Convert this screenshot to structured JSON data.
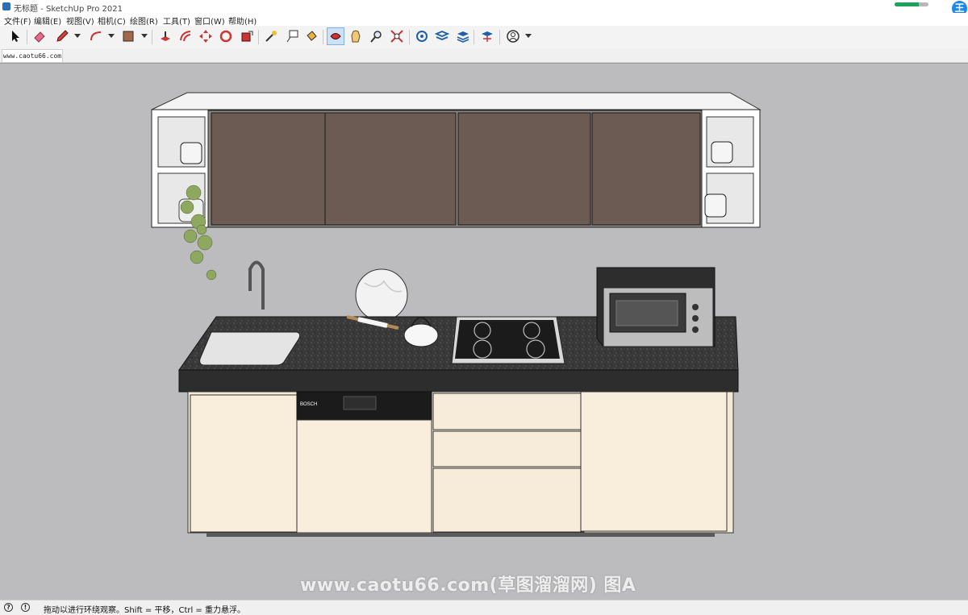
{
  "window": {
    "title": "无标题 - SketchUp Pro 2021",
    "user_initial": "王",
    "progress_fraction": 0.72
  },
  "menu": {
    "items": [
      "文件(F)",
      "编辑(E)",
      "视图(V)",
      "相机(C)",
      "绘图(R)",
      "工具(T)",
      "窗口(W)",
      "帮助(H)"
    ]
  },
  "toolbar": {
    "tools": [
      "select-tool",
      "eraser-tool",
      "pencil-tool",
      "arc-tool",
      "shape-tool",
      "push-pull-tool",
      "offset-tool",
      "move-tool",
      "rotate-tool",
      "scale-tool",
      "tape-measure-tool",
      "text-tool",
      "paint-bucket-tool",
      "orbit-tool",
      "pan-tool",
      "zoom-tool",
      "zoom-extents-tool",
      "warehouse-tool",
      "extension-tool",
      "layers-tool",
      "sandbox-tool",
      "account-tool"
    ]
  },
  "scene_tab": {
    "label": "www.caotu66.com"
  },
  "model": {
    "brand_label": "BOSCH"
  },
  "watermark": {
    "text": "www.caotu66.com(草图溜溜网) 图A"
  },
  "status": {
    "text": "拖动以进行环绕观察。Shift = 平移，Ctrl = 重力悬浮。",
    "info_icon": "info-icon",
    "geo_icon": "geo-location-icon"
  },
  "colors": {
    "viewport_bg": "#bcbcbf",
    "cabinet": "#f6ecda",
    "countertop": "#3c3b3b",
    "glass": "#6b5a51",
    "accent": "#1e88e5"
  }
}
